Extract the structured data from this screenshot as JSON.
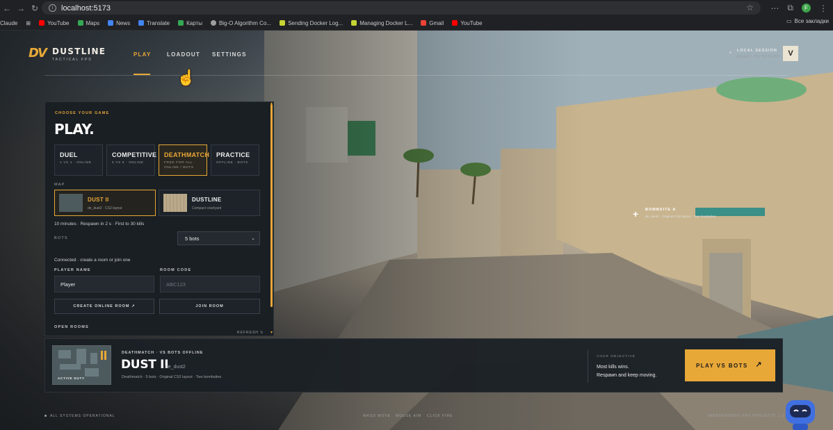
{
  "browser": {
    "url": "localhost:5173",
    "profile_initial": "F",
    "bookmarks": [
      {
        "label": "Claude",
        "color": "#d97757"
      },
      {
        "label": "YouTube",
        "color": "#ff0000"
      },
      {
        "label": "Maps",
        "color": "#34a853"
      },
      {
        "label": "News",
        "color": "#4285f4"
      },
      {
        "label": "Translate",
        "color": "#4285f4"
      },
      {
        "label": "Карты",
        "color": "#34a853"
      },
      {
        "label": "Big-O Algorithm Co...",
        "color": "#9e9e9e"
      },
      {
        "label": "Sending Docker Log...",
        "color": "#c6d533"
      },
      {
        "label": "Managing Docker L...",
        "color": "#c6d533"
      },
      {
        "label": "Gmail",
        "color": "#ea4335"
      },
      {
        "label": "YouTube",
        "color": "#ff0000"
      }
    ],
    "all_bookmarks": "Все закладки"
  },
  "header": {
    "logo_mark": "DV",
    "brand": "DUSTLINE",
    "tagline": "TACTICAL FPS",
    "nav": {
      "play": "PLAY",
      "loadout": "LOADOUT",
      "settings": "SETTINGS"
    },
    "session_title": "LOCAL SESSION",
    "session_sub": "READY TO DEPLOY",
    "avatar_letter": "V"
  },
  "panel": {
    "eyebrow": "CHOOSE YOUR GAME",
    "heading": "PLAY.",
    "modes": [
      {
        "title": "DUEL",
        "sub": "1 VS 1 · ONLINE"
      },
      {
        "title": "COMPETITIVE",
        "sub": "5 VS 5 · ONLINE"
      },
      {
        "title": "DEATHMATCH",
        "sub": "FREE FOR ALL · ONLINE / BOTS"
      },
      {
        "title": "PRACTICE",
        "sub": "OFFLINE · BOTS"
      }
    ],
    "map_label": "MAP",
    "maps": [
      {
        "title": "DUST II",
        "sub": "de_dust2 · CS2 layout"
      },
      {
        "title": "DUSTLINE",
        "sub": "Compact courtyard"
      }
    ],
    "rules": "10 minutes · Respawn in 2 s · First to 30 kills",
    "bots_label": "BOTS",
    "bots_value": "5 bots",
    "connection": "Connected · create a room or join one",
    "player_name_label": "PLAYER NAME",
    "player_name_value": "Player",
    "room_code_label": "ROOM CODE",
    "room_code_placeholder": "ABC123",
    "create_room": "CREATE ONLINE ROOM ↗",
    "join_room": "JOIN ROOM",
    "open_rooms": "OPEN ROOMS",
    "refresh": "REFRESH ↻"
  },
  "bottom": {
    "active_duty": "ACTIVE DUTY",
    "mode_meta": "DEATHMATCH   ·   VS BOTS OFFLINE",
    "map_title": "DUST II",
    "map_code": "de_dust2",
    "details": "Deathmatch   ·   5 bots   ·   Original CS2 layout · Two bombsites",
    "objective_label": "YOUR OBJECTIVE",
    "objective_line1": "Most kills wins.",
    "objective_line2": "Respawn and keep moving.",
    "play_button": "PLAY VS BOTS",
    "play_arrow": "↗"
  },
  "bombsite": {
    "title": "BOMBSITE A",
    "sub": "de_dust2 · Original CS2 layout · Two bombsites"
  },
  "footer": {
    "status": "ALL SYSTEMS OPERATIONAL",
    "wasd": "WASD MOVE",
    "mouse": "MOUSE AIM",
    "click": "CLICK FIRE",
    "fan": "INDEPENDENT FAN PROJECT",
    "version": "V 1.0"
  },
  "colors": {
    "accent": "#e8a838",
    "panel_bg": "#1a1f24"
  }
}
